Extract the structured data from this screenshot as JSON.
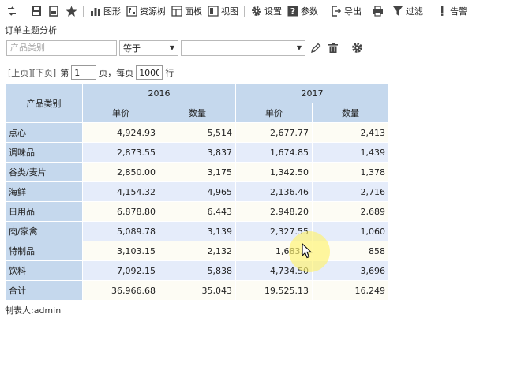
{
  "toolbar": {
    "items": [
      {
        "label": "",
        "icon": "refresh-icon"
      },
      {
        "label": "",
        "icon": "save-icon"
      },
      {
        "label": "",
        "icon": "save-as-icon"
      },
      {
        "label": "",
        "icon": "star-icon"
      },
      {
        "label": "图形",
        "icon": "chart-icon"
      },
      {
        "label": "资源树",
        "icon": "tree-icon"
      },
      {
        "label": "面板",
        "icon": "panel-icon"
      },
      {
        "label": "视图",
        "icon": "view-icon"
      },
      {
        "label": "设置",
        "icon": "gear-icon"
      },
      {
        "label": "参数",
        "icon": "help-icon"
      },
      {
        "label": "导出",
        "icon": "export-icon"
      },
      {
        "label": "",
        "icon": "print-icon"
      },
      {
        "label": "过滤",
        "icon": "filter-icon"
      },
      {
        "label": "告警",
        "icon": "alert-icon"
      }
    ]
  },
  "report_title": "订单主题分析",
  "filter": {
    "field_placeholder": "产品类别",
    "operator": "等于",
    "value": ""
  },
  "paging": {
    "prev": "[上页]",
    "next": "[下页]",
    "page_prefix": "第",
    "page_value": "1",
    "page_suffix": "页，每页",
    "per_page_value": "1000",
    "rows_suffix": "行"
  },
  "table": {
    "row_header": "产品类别",
    "years": [
      "2016",
      "2017"
    ],
    "measures": [
      "单价",
      "数量",
      "单价",
      "数量"
    ],
    "rows": [
      {
        "category": "点心",
        "values": [
          "4,924.93",
          "5,514",
          "2,677.77",
          "2,413"
        ]
      },
      {
        "category": "调味品",
        "values": [
          "2,873.55",
          "3,837",
          "1,674.85",
          "1,439"
        ]
      },
      {
        "category": "谷类/麦片",
        "values": [
          "2,850.00",
          "3,175",
          "1,342.50",
          "1,378"
        ]
      },
      {
        "category": "海鲜",
        "values": [
          "4,154.32",
          "4,965",
          "2,136.46",
          "2,716"
        ]
      },
      {
        "category": "日用品",
        "values": [
          "6,878.80",
          "6,443",
          "2,948.20",
          "2,689"
        ]
      },
      {
        "category": "肉/家禽",
        "values": [
          "5,089.78",
          "3,139",
          "2,327.55",
          "1,060"
        ]
      },
      {
        "category": "特制品",
        "values": [
          "3,103.15",
          "2,132",
          "1,683.5",
          "858"
        ]
      },
      {
        "category": "饮料",
        "values": [
          "7,092.15",
          "5,838",
          "4,734.50",
          "3,696"
        ]
      }
    ],
    "total": {
      "category": "合计",
      "values": [
        "36,966.68",
        "35,043",
        "19,525.13",
        "16,249"
      ]
    }
  },
  "footer": "制表人:admin",
  "colors": {
    "header_bg": "#c5d8ed",
    "row_odd": "#fdfcf4",
    "row_even": "#e5ecfa",
    "icon": "#4a4a4a"
  }
}
